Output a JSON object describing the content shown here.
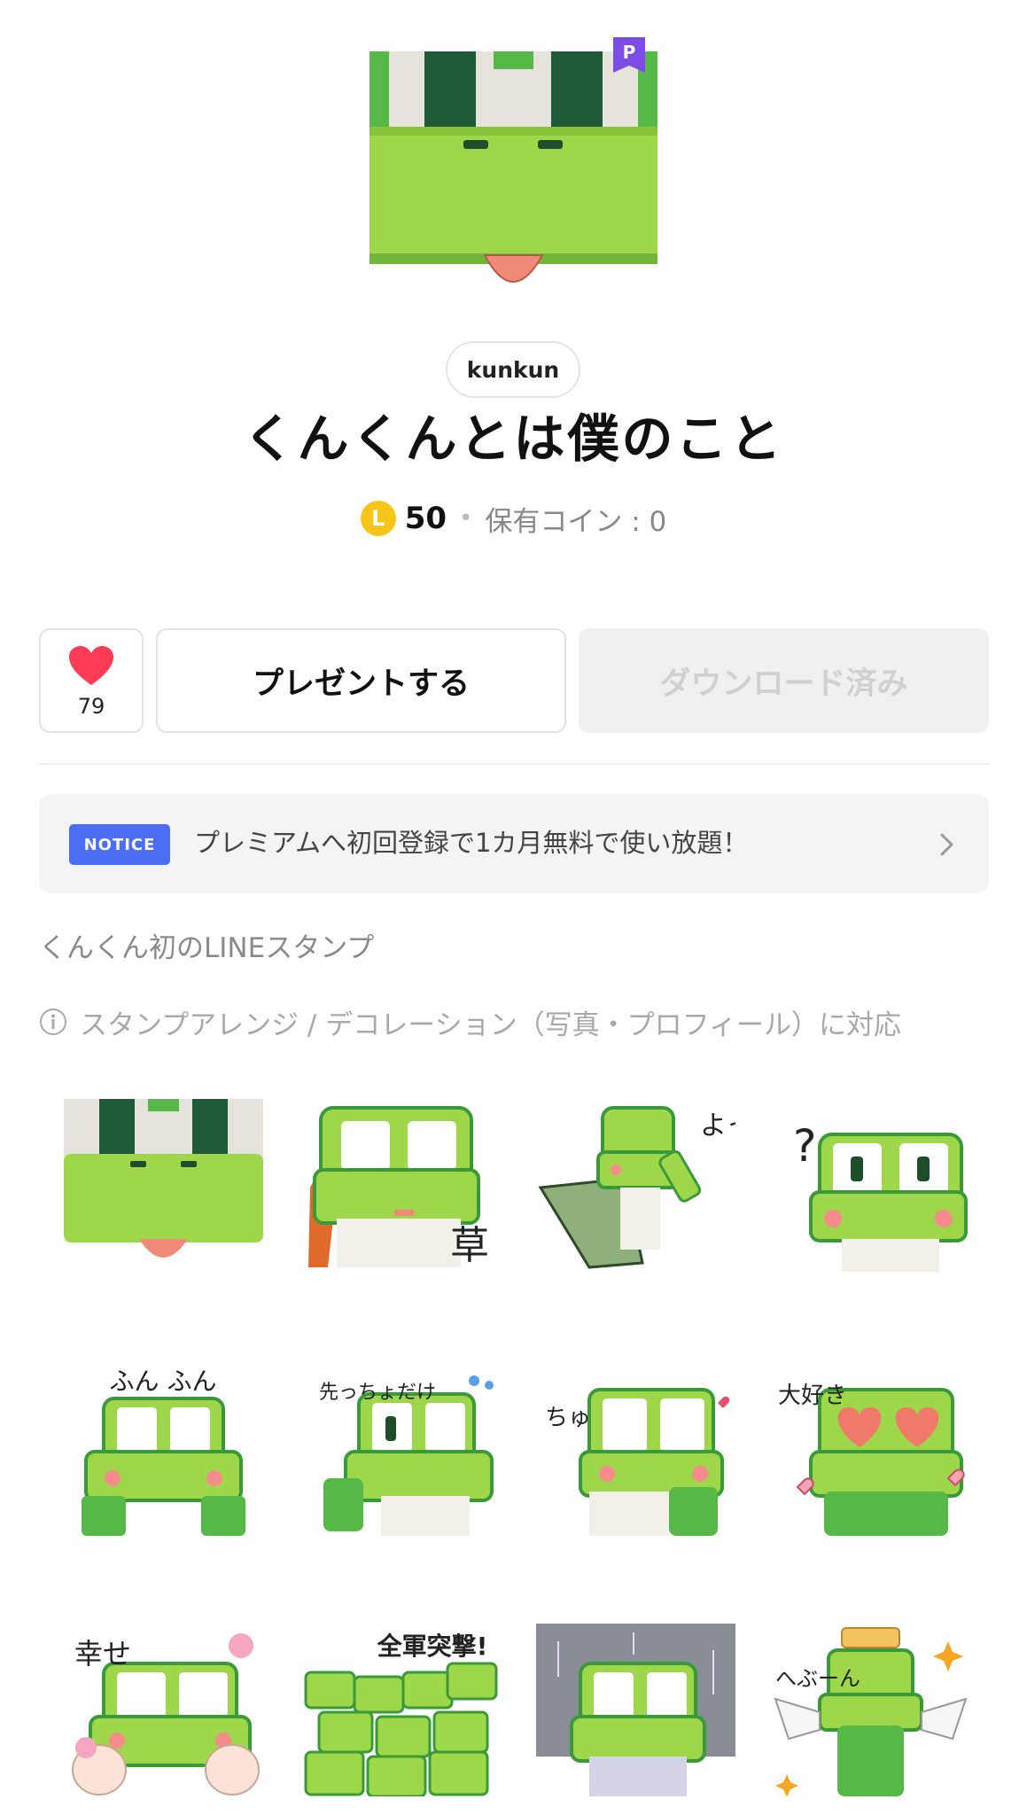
{
  "header": {
    "premium_badge": "P",
    "author": "kunkun",
    "title": "くんくんとは僕のこと",
    "coin_symbol": "L",
    "price": "50",
    "owned_coins": "保有コイン : 0"
  },
  "actions": {
    "like_count": "79",
    "gift_label": "プレゼントする",
    "download_label": "ダウンロード済み"
  },
  "notice": {
    "badge": "NOTICE",
    "text": "プレミアムへ初回登録で1カ月無料で使い放題！"
  },
  "description": "くんくん初のLINEスタンプ",
  "features": "スタンプアレンジ / デコレーション（写真・プロフィール）に対応",
  "stickers": [
    {
      "name": "sticker-closeup",
      "text": ""
    },
    {
      "name": "sticker-kusa",
      "text": "草"
    },
    {
      "name": "sticker-yo",
      "text": "よっ"
    },
    {
      "name": "sticker-question",
      "text": "?"
    },
    {
      "name": "sticker-fun-fun",
      "text": "ふん ふん"
    },
    {
      "name": "sticker-saki-dake",
      "text": "先っちょだけ"
    },
    {
      "name": "sticker-chu",
      "text": "ちゅ"
    },
    {
      "name": "sticker-daisuki",
      "text": "大好き"
    },
    {
      "name": "sticker-shiawase",
      "text": "幸せ"
    },
    {
      "name": "sticker-zengun-totsugeki",
      "text": "全軍突撃!"
    },
    {
      "name": "sticker-rain",
      "text": ""
    },
    {
      "name": "sticker-hebuun",
      "text": "へぶーん"
    }
  ],
  "colors": {
    "frog_green": "#9ed84a",
    "frog_dark": "#3a9a3a",
    "notice_blue": "#4b6ef5",
    "heart_red": "#ff3b55",
    "coin_yellow": "#f5c518"
  }
}
